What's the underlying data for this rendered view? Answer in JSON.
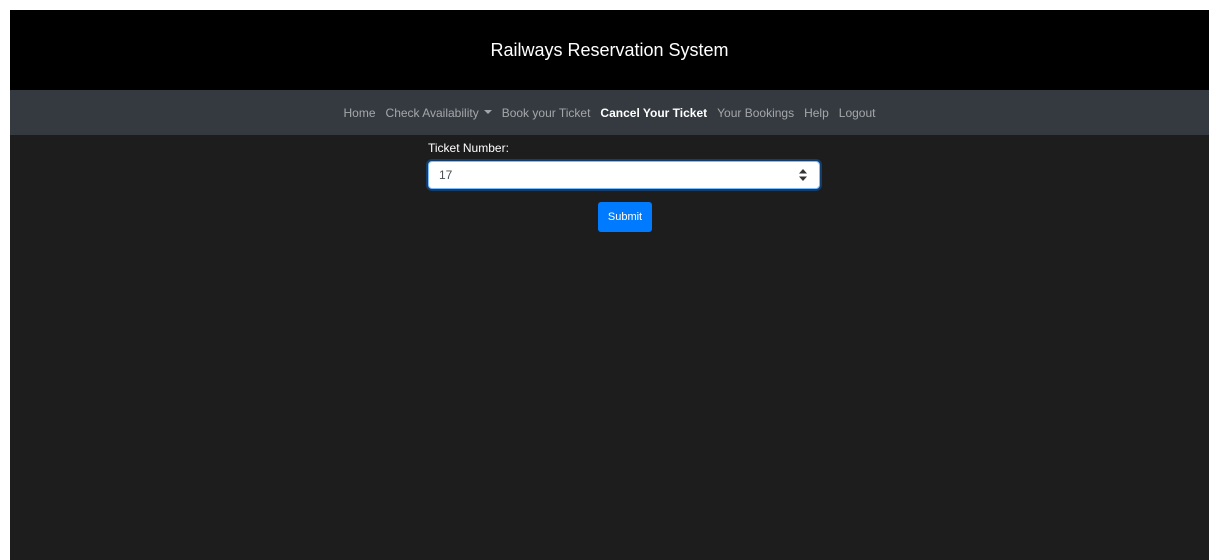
{
  "header": {
    "title": "Railways Reservation System"
  },
  "nav": {
    "items": [
      {
        "label": "Home"
      },
      {
        "label": "Check Availability"
      },
      {
        "label": "Book your Ticket"
      },
      {
        "label": "Cancel Your Ticket"
      },
      {
        "label": "Your Bookings"
      },
      {
        "label": "Help"
      },
      {
        "label": "Logout"
      }
    ],
    "active_item": "Cancel Your Ticket"
  },
  "form": {
    "ticket_label": "Ticket Number:",
    "ticket_value": "17",
    "submit_label": "Submit"
  },
  "colors": {
    "header_bg": "#000000",
    "navbar_bg": "#343a40",
    "page_bg": "#1e1d1e",
    "accent": "#007bff"
  },
  "icons": {
    "dropdown": "caret-down-icon",
    "number_spinner": "spinner-arrows-icon"
  }
}
